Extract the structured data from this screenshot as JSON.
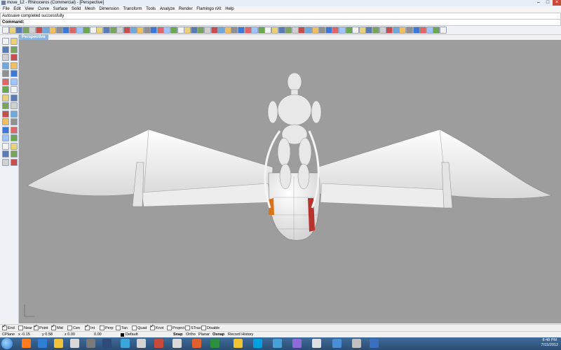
{
  "window": {
    "title": "move_12 - Rhinoceros (Commercial) - [Perspective]"
  },
  "menu": [
    "File",
    "Edit",
    "View",
    "Curve",
    "Surface",
    "Solid",
    "Mesh",
    "Dimension",
    "Transform",
    "Tools",
    "Analyze",
    "Render",
    "Flamingo nXt",
    "Help"
  ],
  "command_history": "Autosave completed successfully",
  "command_prompt": "Command:",
  "viewport": {
    "label": "Perspective",
    "background": "#9d9d9d"
  },
  "osnaps": [
    {
      "label": "End",
      "checked": true
    },
    {
      "label": "Near",
      "checked": false
    },
    {
      "label": "Point",
      "checked": true
    },
    {
      "label": "Mid",
      "checked": true
    },
    {
      "label": "Cen",
      "checked": false
    },
    {
      "label": "Int",
      "checked": true
    },
    {
      "label": "Perp",
      "checked": false
    },
    {
      "label": "Tan",
      "checked": false
    },
    {
      "label": "Quad",
      "checked": false
    },
    {
      "label": "Knot",
      "checked": true
    },
    {
      "label": "Project",
      "checked": false
    },
    {
      "label": "STrack",
      "checked": false
    },
    {
      "label": "Disable",
      "checked": false
    }
  ],
  "status": {
    "cplane": "CPlane",
    "x": "x -0.15",
    "y": "y 0.58",
    "z": "z 0.00",
    "dist": "0.00",
    "layer": "Default",
    "snap": "Snap",
    "ortho": "Ortho",
    "planar": "Planar",
    "osnap": "Osnap",
    "record": "Record History"
  },
  "clock": {
    "time": "8:48 PM",
    "date": "7/15/2012"
  }
}
